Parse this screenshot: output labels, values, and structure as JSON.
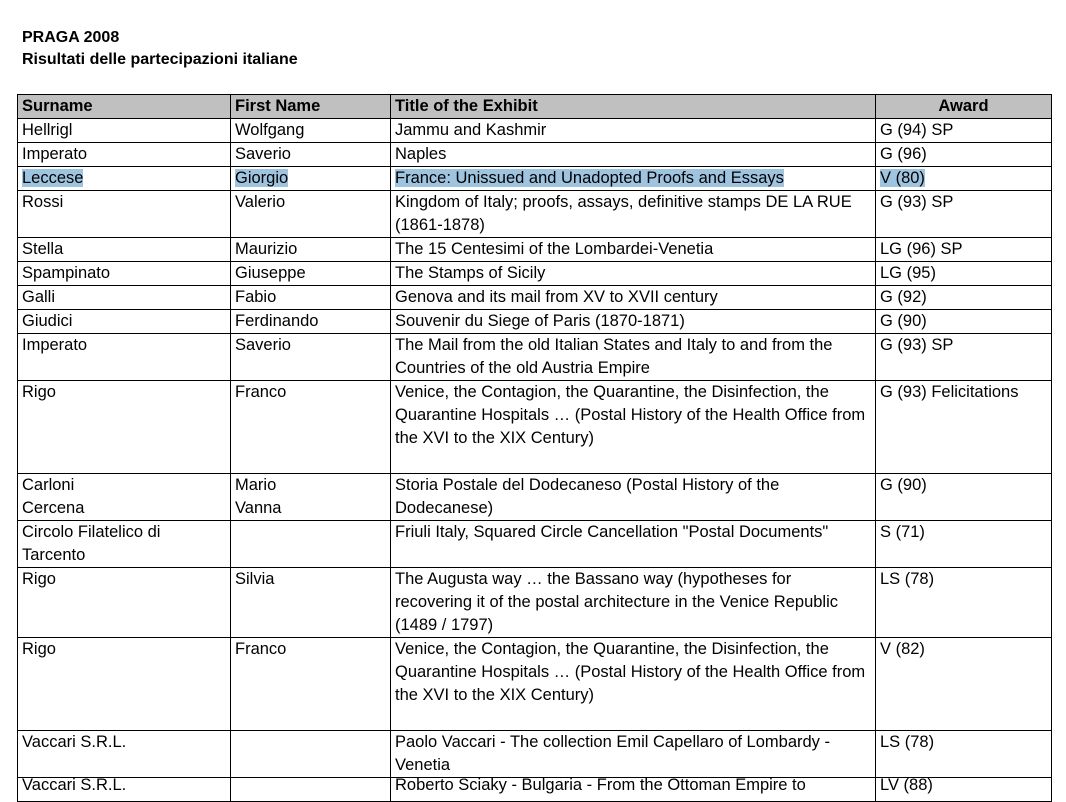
{
  "header": {
    "line1": "PRAGA 2008",
    "line2": "Risultati delle partecipazioni italiane"
  },
  "table": {
    "columns": [
      "Surname",
      "First Name",
      "Title of the Exhibit",
      "Award"
    ],
    "rows": [
      {
        "surname": "Hellrigl",
        "first_name": "Wolfgang",
        "title": "Jammu and Kashmir",
        "award": "G (94) SP"
      },
      {
        "surname": "Imperato",
        "first_name": "Saverio",
        "title": "Naples",
        "award": "G (96)"
      },
      {
        "surname": "Leccese",
        "first_name": "Giorgio",
        "title": "France: Unissued and Unadopted Proofs and Essays",
        "award": "V (80)",
        "selected": true
      },
      {
        "surname": "Rossi",
        "first_name": "Valerio",
        "title": "Kingdom of Italy; proofs, assays, definitive stamps DE LA RUE (1861-1878)",
        "award": "G (93) SP"
      },
      {
        "surname": "Stella",
        "first_name": "Maurizio",
        "title": "The 15 Centesimi of the Lombardei-Venetia",
        "award": "LG (96) SP"
      },
      {
        "surname": "Spampinato",
        "first_name": "Giuseppe",
        "title": "The Stamps of Sicily",
        "award": "LG (95)"
      },
      {
        "surname": "Galli",
        "first_name": "Fabio",
        "title": "Genova and its mail from XV to XVII century",
        "award": "G (92)"
      },
      {
        "surname": "Giudici",
        "first_name": "Ferdinando",
        "title": "Souvenir du Siege of Paris (1870-1871)",
        "award": "G (90)"
      },
      {
        "surname": "Imperato",
        "first_name": "Saverio",
        "title": "The Mail from the old Italian States and Italy to and from the Countries of the old Austria Empire",
        "award": "G (93) SP"
      },
      {
        "surname": "Rigo",
        "first_name": "Franco",
        "title": "Venice, the Contagion, the Quarantine, the Disinfection, the Quarantine Hospitals … (Postal History of the Health Office from the XVI to the XIX Century)",
        "award": "G (93) Felicitations",
        "extra_line": true
      },
      {
        "surname": "Carloni\nCercena",
        "first_name": "Mario\nVanna",
        "title": "Storia Postale del Dodecaneso (Postal History of the Dodecanese)",
        "award": "G (90)"
      },
      {
        "surname": "Circolo Filatelico di Tarcento",
        "first_name": "",
        "title": "Friuli Italy, Squared Circle Cancellation \"Postal Documents\"",
        "award": "S (71)"
      },
      {
        "surname": "Rigo",
        "first_name": "Silvia",
        "title": "The Augusta way … the Bassano way (hypotheses for recovering it of the postal architecture in the Venice Republic (1489 / 1797)",
        "award": "LS (78)"
      },
      {
        "surname": "Rigo",
        "first_name": "Franco",
        "title": "Venice, the Contagion, the Quarantine, the Disinfection, the Quarantine Hospitals … (Postal History of the Health Office from the XVI to the XIX Century)",
        "award": "V (82)",
        "extra_line": true
      },
      {
        "surname": "Vaccari S.R.L.",
        "first_name": "",
        "title": "Paolo Vaccari - The collection Emil Capellaro of Lombardy - Venetia",
        "award": "LS (78)"
      },
      {
        "surname": "Vaccari S.R.L.",
        "first_name": "",
        "title": "Roberto Sciaky - Bulgaria - From the Ottoman Empire to",
        "award": "LV (88)",
        "cut": true
      }
    ]
  }
}
